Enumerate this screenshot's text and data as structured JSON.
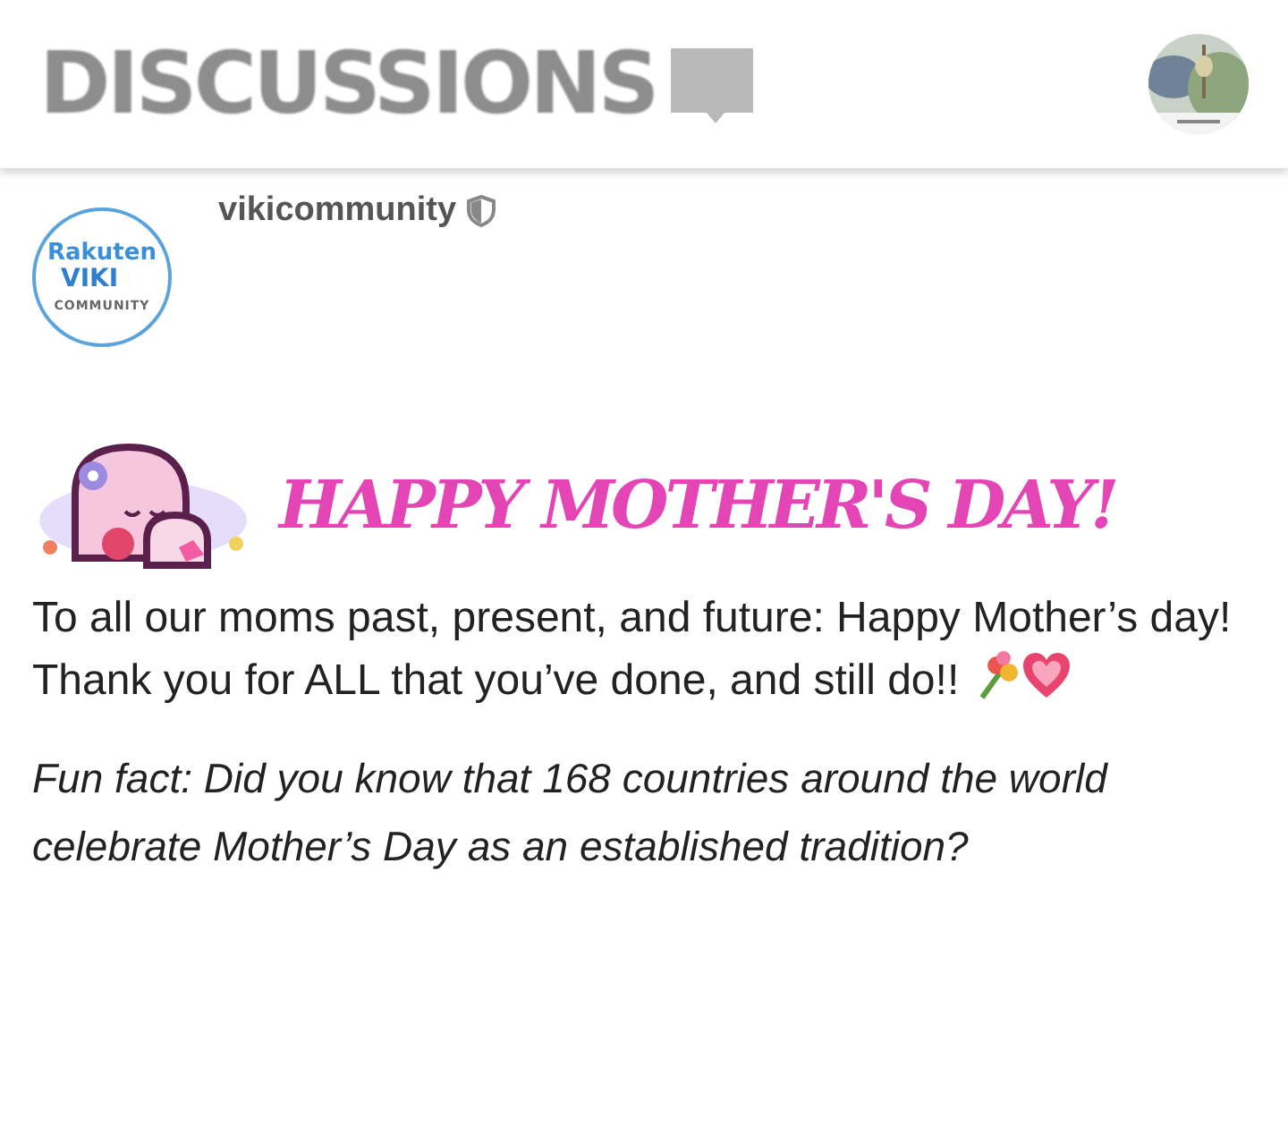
{
  "header": {
    "title": "DISCUSSIONS"
  },
  "post": {
    "logo": {
      "brand": "Rakuten",
      "product": "VIKI",
      "tagline": "COMMUNITY"
    },
    "author": "vikicommunity",
    "banner": "HAPPY MOTHER'S DAY!",
    "paragraphs": [
      {
        "kind": "plain",
        "text": "To all our moms past, present, and future: Happy Mother’s day! Thank you for ALL that you’ve done, and still do!!"
      },
      {
        "kind": "italic",
        "text": "Fun fact: Did you know that 168 countries around the world celebrate Mother’s Day as an established tradition?"
      }
    ]
  }
}
